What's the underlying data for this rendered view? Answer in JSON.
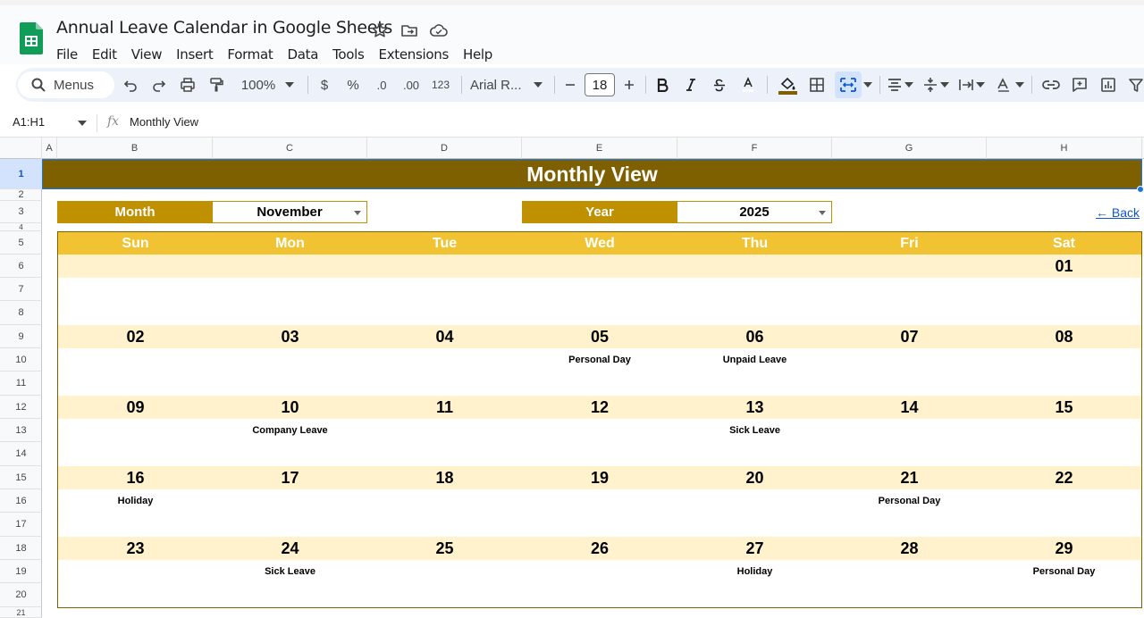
{
  "app": {
    "doc_title": "Annual Leave Calendar in Google Sheets",
    "menus": [
      "File",
      "Edit",
      "View",
      "Insert",
      "Format",
      "Data",
      "Tools",
      "Extensions",
      "Help"
    ]
  },
  "toolbar": {
    "search_label": "Menus",
    "zoom": "100%",
    "currency": "$",
    "percent": "%",
    "dec_decrease": ".0",
    "dec_increase": ".00",
    "number_format": "123",
    "font": "Arial R...",
    "font_size": "18"
  },
  "formula_bar": {
    "name_box": "A1:H1",
    "fx": "fx",
    "formula": "Monthly View"
  },
  "columns": [
    "A",
    "B",
    "C",
    "D",
    "E",
    "F",
    "G",
    "H"
  ],
  "rows": [
    "1",
    "2",
    "3",
    "4",
    "5",
    "6",
    "7",
    "8",
    "9",
    "10",
    "11",
    "12",
    "13",
    "14",
    "15",
    "16",
    "17",
    "18",
    "19",
    "20",
    "21"
  ],
  "sheet": {
    "title": "Monthly View",
    "month_label": "Month",
    "month_value": "November",
    "year_label": "Year",
    "year_value": "2025",
    "back_link": "← Back",
    "colors": {
      "title_bg": "#7f6000",
      "label_bg": "#bf9000",
      "day_header_bg": "#f1c232",
      "week_band_bg": "#fff2cc"
    }
  },
  "calendar": {
    "day_headers": [
      "Sun",
      "Mon",
      "Tue",
      "Wed",
      "Thu",
      "Fri",
      "Sat"
    ],
    "weeks": [
      {
        "days": [
          "",
          "",
          "",
          "",
          "",
          "",
          "01"
        ],
        "events": [
          "",
          "",
          "",
          "",
          "",
          "",
          ""
        ]
      },
      {
        "days": [
          "02",
          "03",
          "04",
          "05",
          "06",
          "07",
          "08"
        ],
        "events": [
          "",
          "",
          "",
          "Personal Day",
          "Unpaid Leave",
          "",
          ""
        ]
      },
      {
        "days": [
          "09",
          "10",
          "11",
          "12",
          "13",
          "14",
          "15"
        ],
        "events": [
          "",
          "Company Leave",
          "",
          "",
          "Sick Leave",
          "",
          ""
        ]
      },
      {
        "days": [
          "16",
          "17",
          "18",
          "19",
          "20",
          "21",
          "22"
        ],
        "events": [
          "Holiday",
          "",
          "",
          "",
          "",
          "Personal Day",
          ""
        ]
      },
      {
        "days": [
          "23",
          "24",
          "25",
          "26",
          "27",
          "28",
          "29"
        ],
        "events": [
          "",
          "Sick Leave",
          "",
          "",
          "Holiday",
          "",
          "Personal Day"
        ]
      }
    ]
  }
}
